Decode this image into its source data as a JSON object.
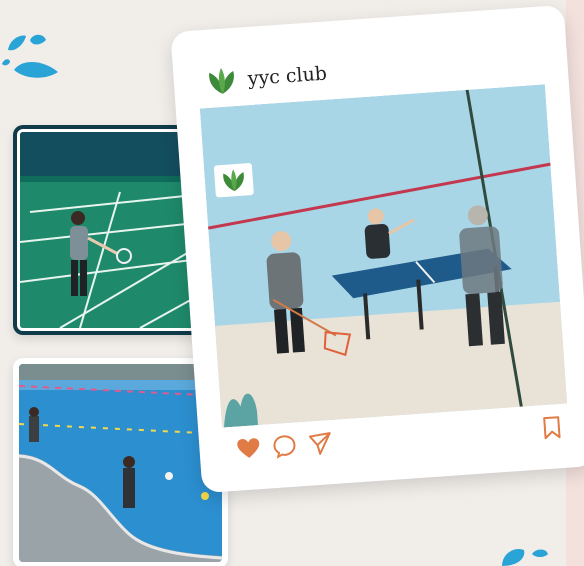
{
  "post": {
    "account_name": "yyc club",
    "logo_icon": "leaf-logo-icon",
    "actions": [
      {
        "name": "like",
        "icon": "heart-icon",
        "color": "#e07b45"
      },
      {
        "name": "comment",
        "icon": "comment-bubble-icon",
        "color": "#e07b45"
      },
      {
        "name": "share",
        "icon": "send-arrow-icon",
        "color": "#e07b45"
      },
      {
        "name": "save",
        "icon": "bookmark-icon",
        "color": "#e07b45"
      }
    ]
  },
  "photos": [
    {
      "subject": "badminton-court"
    },
    {
      "subject": "swimming-pool"
    },
    {
      "subject": "table-tennis"
    }
  ],
  "colors": {
    "background": "#f1eeea",
    "accent": "#e07b45",
    "brand_green": "#3d8b3a",
    "splash_blue": "#2aa3d6"
  }
}
